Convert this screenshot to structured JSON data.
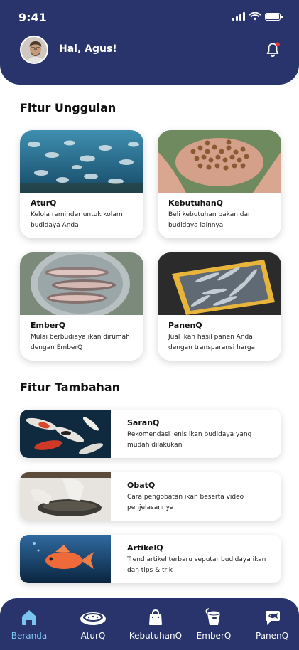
{
  "status_bar": {
    "time": "9:41"
  },
  "header": {
    "greeting": "Hai, Agus!"
  },
  "featured": {
    "title": "Fitur Unggulan",
    "cards": [
      {
        "title": "AturQ",
        "desc": "Kelola reminder untuk kolam budidaya Anda"
      },
      {
        "title": "KebutuhanQ",
        "desc": "Beli kebutuhan pakan dan budidaya lainnya"
      },
      {
        "title": "EmberQ",
        "desc": "Mulai berbudiaya ikan dirumah dengan EmberQ"
      },
      {
        "title": "PanenQ",
        "desc": "Jual ikan hasil panen Anda dengan transparansi harga"
      }
    ]
  },
  "additional": {
    "title": "Fitur Tambahan",
    "items": [
      {
        "title": "SaranQ",
        "desc": "Rekomendasi jenis ikan budidaya yang mudah dilakukan"
      },
      {
        "title": "ObatQ",
        "desc": "Cara pengobatan ikan beserta video penjelasannya"
      },
      {
        "title": "ArtikelQ",
        "desc": "Trend artikel terbaru seputar budidaya ikan dan tips & trik"
      }
    ]
  },
  "nav": {
    "items": [
      {
        "label": "Beranda",
        "icon": "home-icon",
        "active": true
      },
      {
        "label": "AturQ",
        "icon": "pond-icon",
        "active": false
      },
      {
        "label": "KebutuhanQ",
        "icon": "shopping-bag-icon",
        "active": false
      },
      {
        "label": "EmberQ",
        "icon": "bucket-icon",
        "active": false
      },
      {
        "label": "PanenQ",
        "icon": "fish-tag-icon",
        "active": false
      }
    ]
  },
  "colors": {
    "primary": "#28346b",
    "active_nav": "#7cc4f0",
    "notification_dot": "#e53935"
  }
}
